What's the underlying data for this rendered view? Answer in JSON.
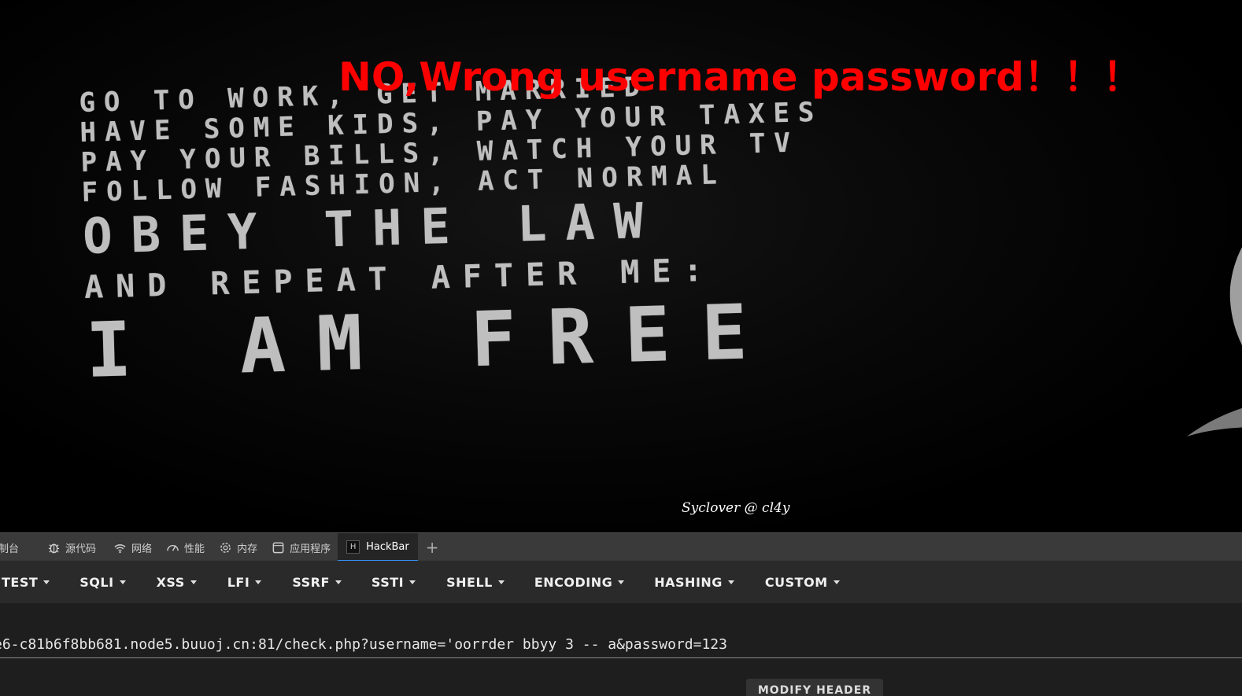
{
  "webpage": {
    "error_message": "NO,Wrong username password！！！",
    "wall_lines": [
      "GO TO WORK, GET MARRIED",
      "HAVE SOME KIDS, PAY YOUR TAXES",
      "PAY YOUR BILLS, WATCH YOUR TV",
      "FOLLOW FASHION, ACT NORMAL",
      "OBEY THE LAW",
      "AND REPEAT AFTER ME:",
      "I AM FREE"
    ],
    "credit": "Syclover @ cl4y",
    "colors": {
      "error": "#ff0000",
      "background": "#000000"
    }
  },
  "devtools": {
    "tabs": [
      {
        "label": "制台",
        "icon": "console-icon"
      },
      {
        "label": "源代码",
        "icon": "bug-icon"
      },
      {
        "label": "网络",
        "icon": "wifi-icon"
      },
      {
        "label": "性能",
        "icon": "gauge-icon"
      },
      {
        "label": "内存",
        "icon": "gear-icon"
      },
      {
        "label": "应用程序",
        "icon": "window-icon"
      },
      {
        "label": "HackBar",
        "icon": "hackbar-icon",
        "active": true
      }
    ],
    "add_tab": "+",
    "accent": "#3794ff"
  },
  "hackbar": {
    "menu": [
      "TEST",
      "SQLI",
      "XSS",
      "LFI",
      "SSRF",
      "SSTI",
      "SHELL",
      "ENCODING",
      "HASHING",
      "CUSTOM"
    ],
    "url": "e6-c81b6f8bb681.node5.buuoj.cn:81/check.php?username='oorrder bbyy 3 -- a&password=123",
    "modify_header": "MODIFY HEADER"
  }
}
